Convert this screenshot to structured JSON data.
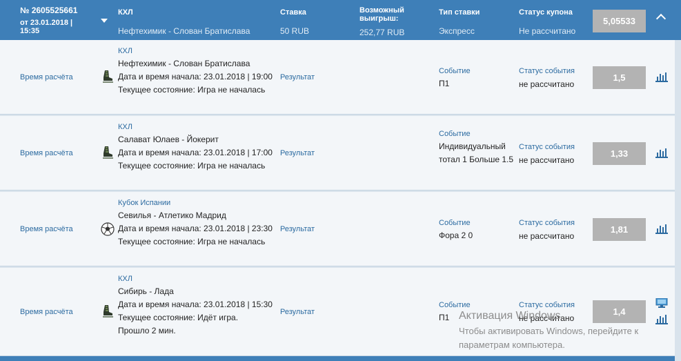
{
  "coupon": {
    "number": "№ 2605525661",
    "date": "от 23.01.2018 | 15:35",
    "league": "КХЛ",
    "match": "Нефтехимик - Слован Братислава",
    "stake_label": "Ставка",
    "stake_value": "50 RUB",
    "win_label": "Возможный выигрыш:",
    "win_value": "252,77 RUB",
    "type_label": "Тип ставки",
    "type_value": "Экспресс",
    "status_label": "Статус купона",
    "status_value": "Не рассчитано",
    "coef": "5,05533"
  },
  "labels": {
    "calc_time": "Время расчёта",
    "result": "Результат",
    "event": "Событие",
    "event_status": "Статус события"
  },
  "rows": [
    {
      "league": "КХЛ",
      "match": "Нефтехимик - Слован Братислава",
      "start": "Дата и время начала: 23.01.2018 | 19:00",
      "state": "Текущее состояние: Игра не началась",
      "extra": "",
      "event": "П1",
      "status": "не рассчитано",
      "coef": "1,5",
      "sport_icon": "hockey-skate-icon"
    },
    {
      "league": "КХЛ",
      "match": "Салават Юлаев - Йокерит",
      "start": "Дата и время начала: 23.01.2018 | 17:00",
      "state": "Текущее состояние: Игра не началась",
      "extra": "",
      "event": "Индивидуальный тотал 1 Больше 1.5",
      "status": "не рассчитано",
      "coef": "1,33",
      "sport_icon": "hockey-skate-icon"
    },
    {
      "league": "Кубок Испании",
      "match": "Севилья - Атлетико Мадрид",
      "start": "Дата и время начала: 23.01.2018 | 23:30",
      "state": "Текущее состояние: Игра не началась",
      "extra": "",
      "event": "Фора 2 0",
      "status": "не рассчитано",
      "coef": "1,81",
      "sport_icon": "soccer-ball-icon"
    },
    {
      "league": "КХЛ",
      "match": "Сибирь - Лада",
      "start": "Дата и время начала: 23.01.2018 | 15:30",
      "state": "Текущее состояние: Идёт игра.",
      "extra": "Прошло 2 мин.",
      "event": "П1",
      "status": "не рассчитано",
      "coef": "1,4",
      "sport_icon": "hockey-skate-icon"
    }
  ],
  "watermark": {
    "title": "Активация Windows",
    "line1": "Чтобы активировать Windows, перейдите к",
    "line2": "параметрам компьютера."
  },
  "colors": {
    "header_bg": "#3e7fb8",
    "row_bg": "#f3f6f9",
    "link": "#2b6aa0",
    "coef_bg": "#b3b3b3"
  }
}
